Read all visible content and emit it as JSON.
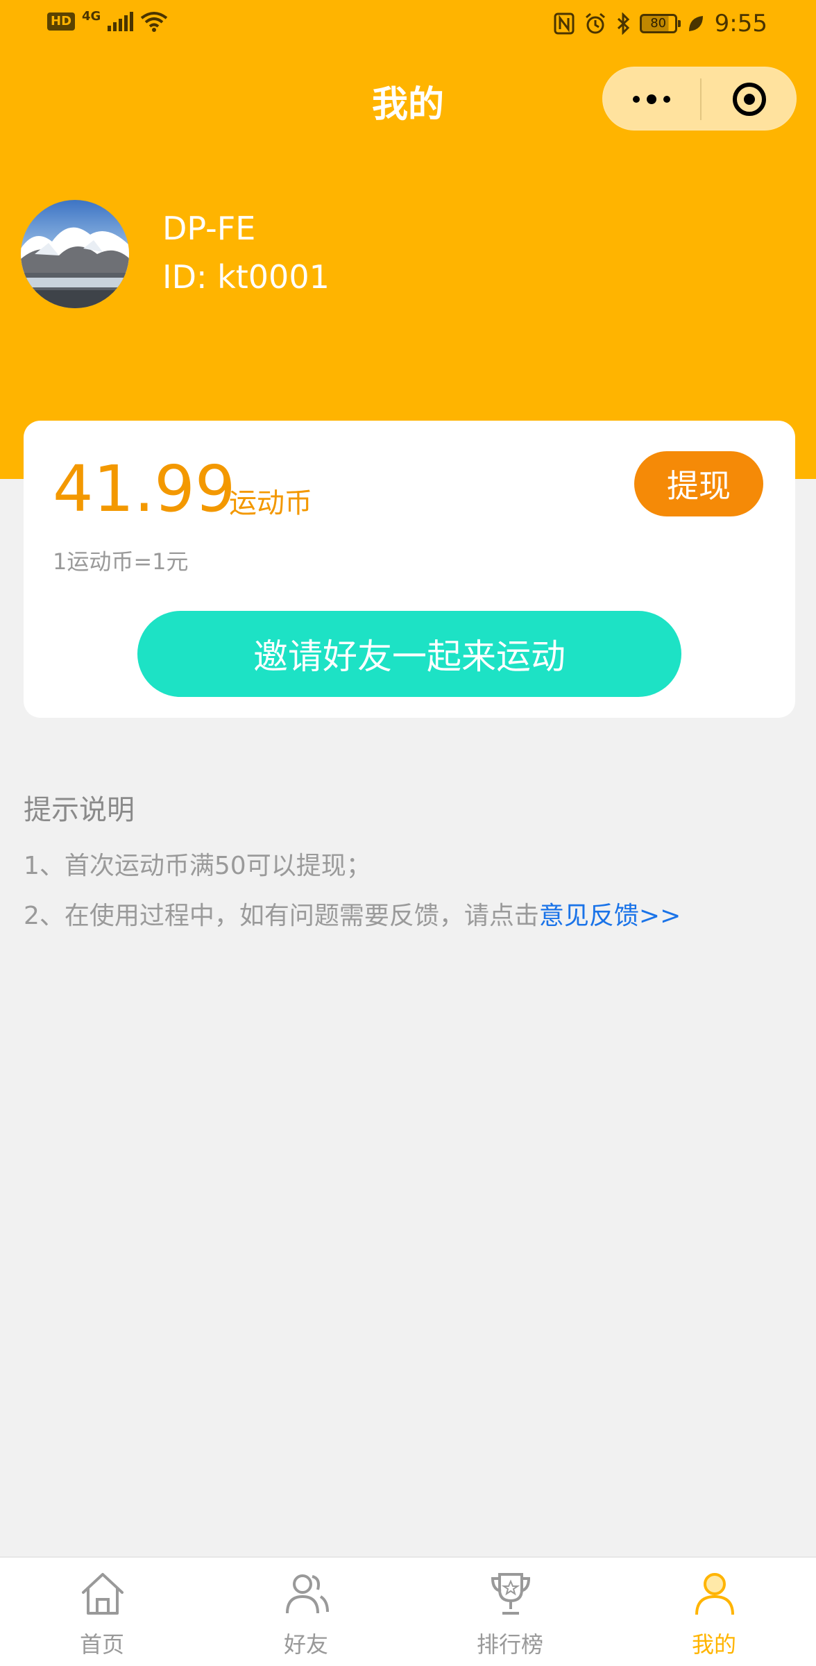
{
  "status_bar": {
    "hd": "HD",
    "network": "4G",
    "battery": "80",
    "time": "9:55"
  },
  "nav": {
    "title": "我的",
    "more_icon": "more-dots-icon",
    "close_icon": "target-close-icon"
  },
  "profile": {
    "name": "DP-FE",
    "id_text": "ID: kt0001"
  },
  "wallet": {
    "balance": "41.99",
    "unit": "运动币",
    "withdraw_label": "提现",
    "rate_note": "1运动币=1元",
    "invite_label": "邀请好友一起来运动"
  },
  "tips": {
    "title": "提示说明",
    "line1": "1、首次运动币满50可以提现；",
    "line2_prefix": "2、在使用过程中，如有问题需要反馈，请点击",
    "line2_link": "意见反馈>>"
  },
  "tabbar": {
    "items": [
      {
        "label": "首页",
        "icon": "home-icon"
      },
      {
        "label": "好友",
        "icon": "friends-icon"
      },
      {
        "label": "排行榜",
        "icon": "trophy-icon"
      },
      {
        "label": "我的",
        "icon": "user-icon",
        "active": true
      }
    ]
  },
  "colors": {
    "brand": "#ffb400",
    "accent_orange": "#f58a07",
    "invite_teal": "#1de2c5",
    "link_blue": "#1a73e8"
  }
}
